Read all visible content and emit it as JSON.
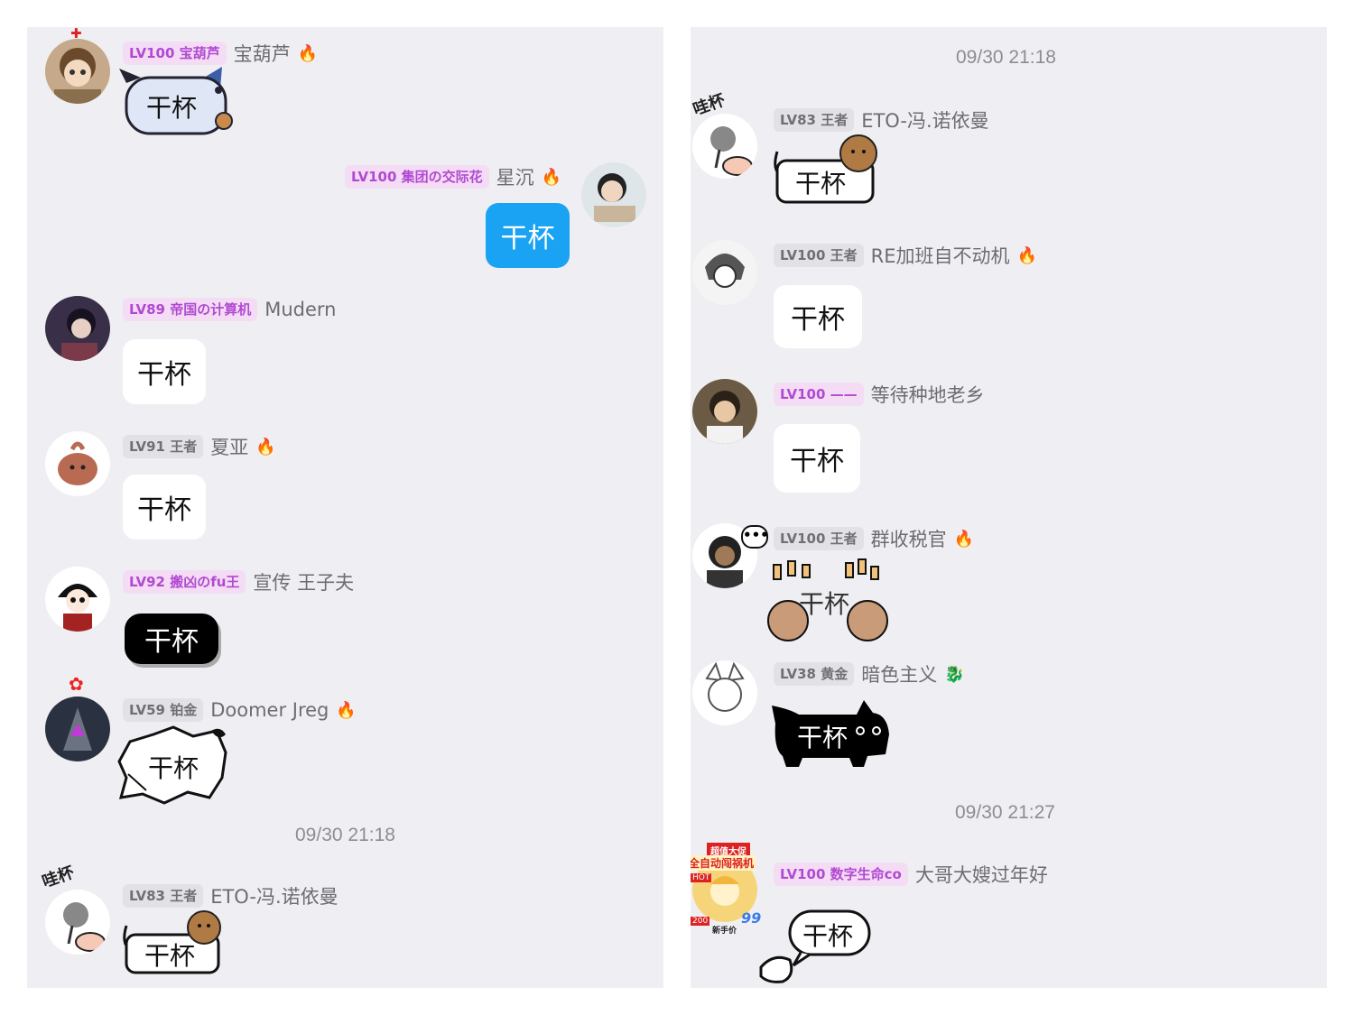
{
  "left_panel": {
    "messages": [
      {
        "level": "LV100 宝葫芦",
        "name": "宝葫芦",
        "text": "干杯"
      },
      {
        "level": "LV100 集团の交际花",
        "name": "星沉",
        "text": "干杯"
      },
      {
        "level": "LV89 帝国の计算机",
        "name": "Mudern",
        "text": "干杯"
      },
      {
        "level": "LV91 王者",
        "name": "夏亚",
        "text": "干杯"
      },
      {
        "level": "LV92 搬凶のfu王",
        "name": "宣传 王子夫",
        "text": "干杯"
      },
      {
        "level": "LV59 铂金",
        "name": "Doomer Jreg",
        "text": "干杯"
      },
      {
        "level": "LV83 王者",
        "name": "ETO-冯.诺依曼",
        "text": "干杯"
      }
    ],
    "timestamp": "09/30 21:18"
  },
  "right_panel": {
    "timestamp_top": "09/30 21:18",
    "messages": [
      {
        "level": "LV83 王者",
        "name": "ETO-冯.诺依曼",
        "text": "干杯",
        "frame_text": "哇杯"
      },
      {
        "level": "LV100 王者",
        "name": "RE加班自不动机",
        "text": "干杯"
      },
      {
        "level": "LV100 ——",
        "name": "等待种地老乡",
        "text": "干杯"
      },
      {
        "level": "LV100 王者",
        "name": "群收税官",
        "text": "干杯"
      },
      {
        "level": "LV38 黄金",
        "name": "暗色主义",
        "text": "干杯"
      },
      {
        "level": "LV100 数字生命co",
        "name": "大哥大嫂过年好",
        "text": "干杯"
      }
    ],
    "timestamp_bottom": "09/30 21:27",
    "ad_frame": {
      "line1": "超值大促",
      "line2": "全自动闯祸机",
      "badge": "99",
      "tag": "HOT",
      "price": "200",
      "sub": "新手价"
    }
  },
  "left_frame_text": "哇杯",
  "colors": {
    "panel_bg": "#efeff3",
    "level_pink_bg": "#f4dcf5",
    "level_pink_text": "#b14ad2",
    "level_gray_bg": "#e2e2e6",
    "blue_bubble": "#1aa3f2"
  }
}
